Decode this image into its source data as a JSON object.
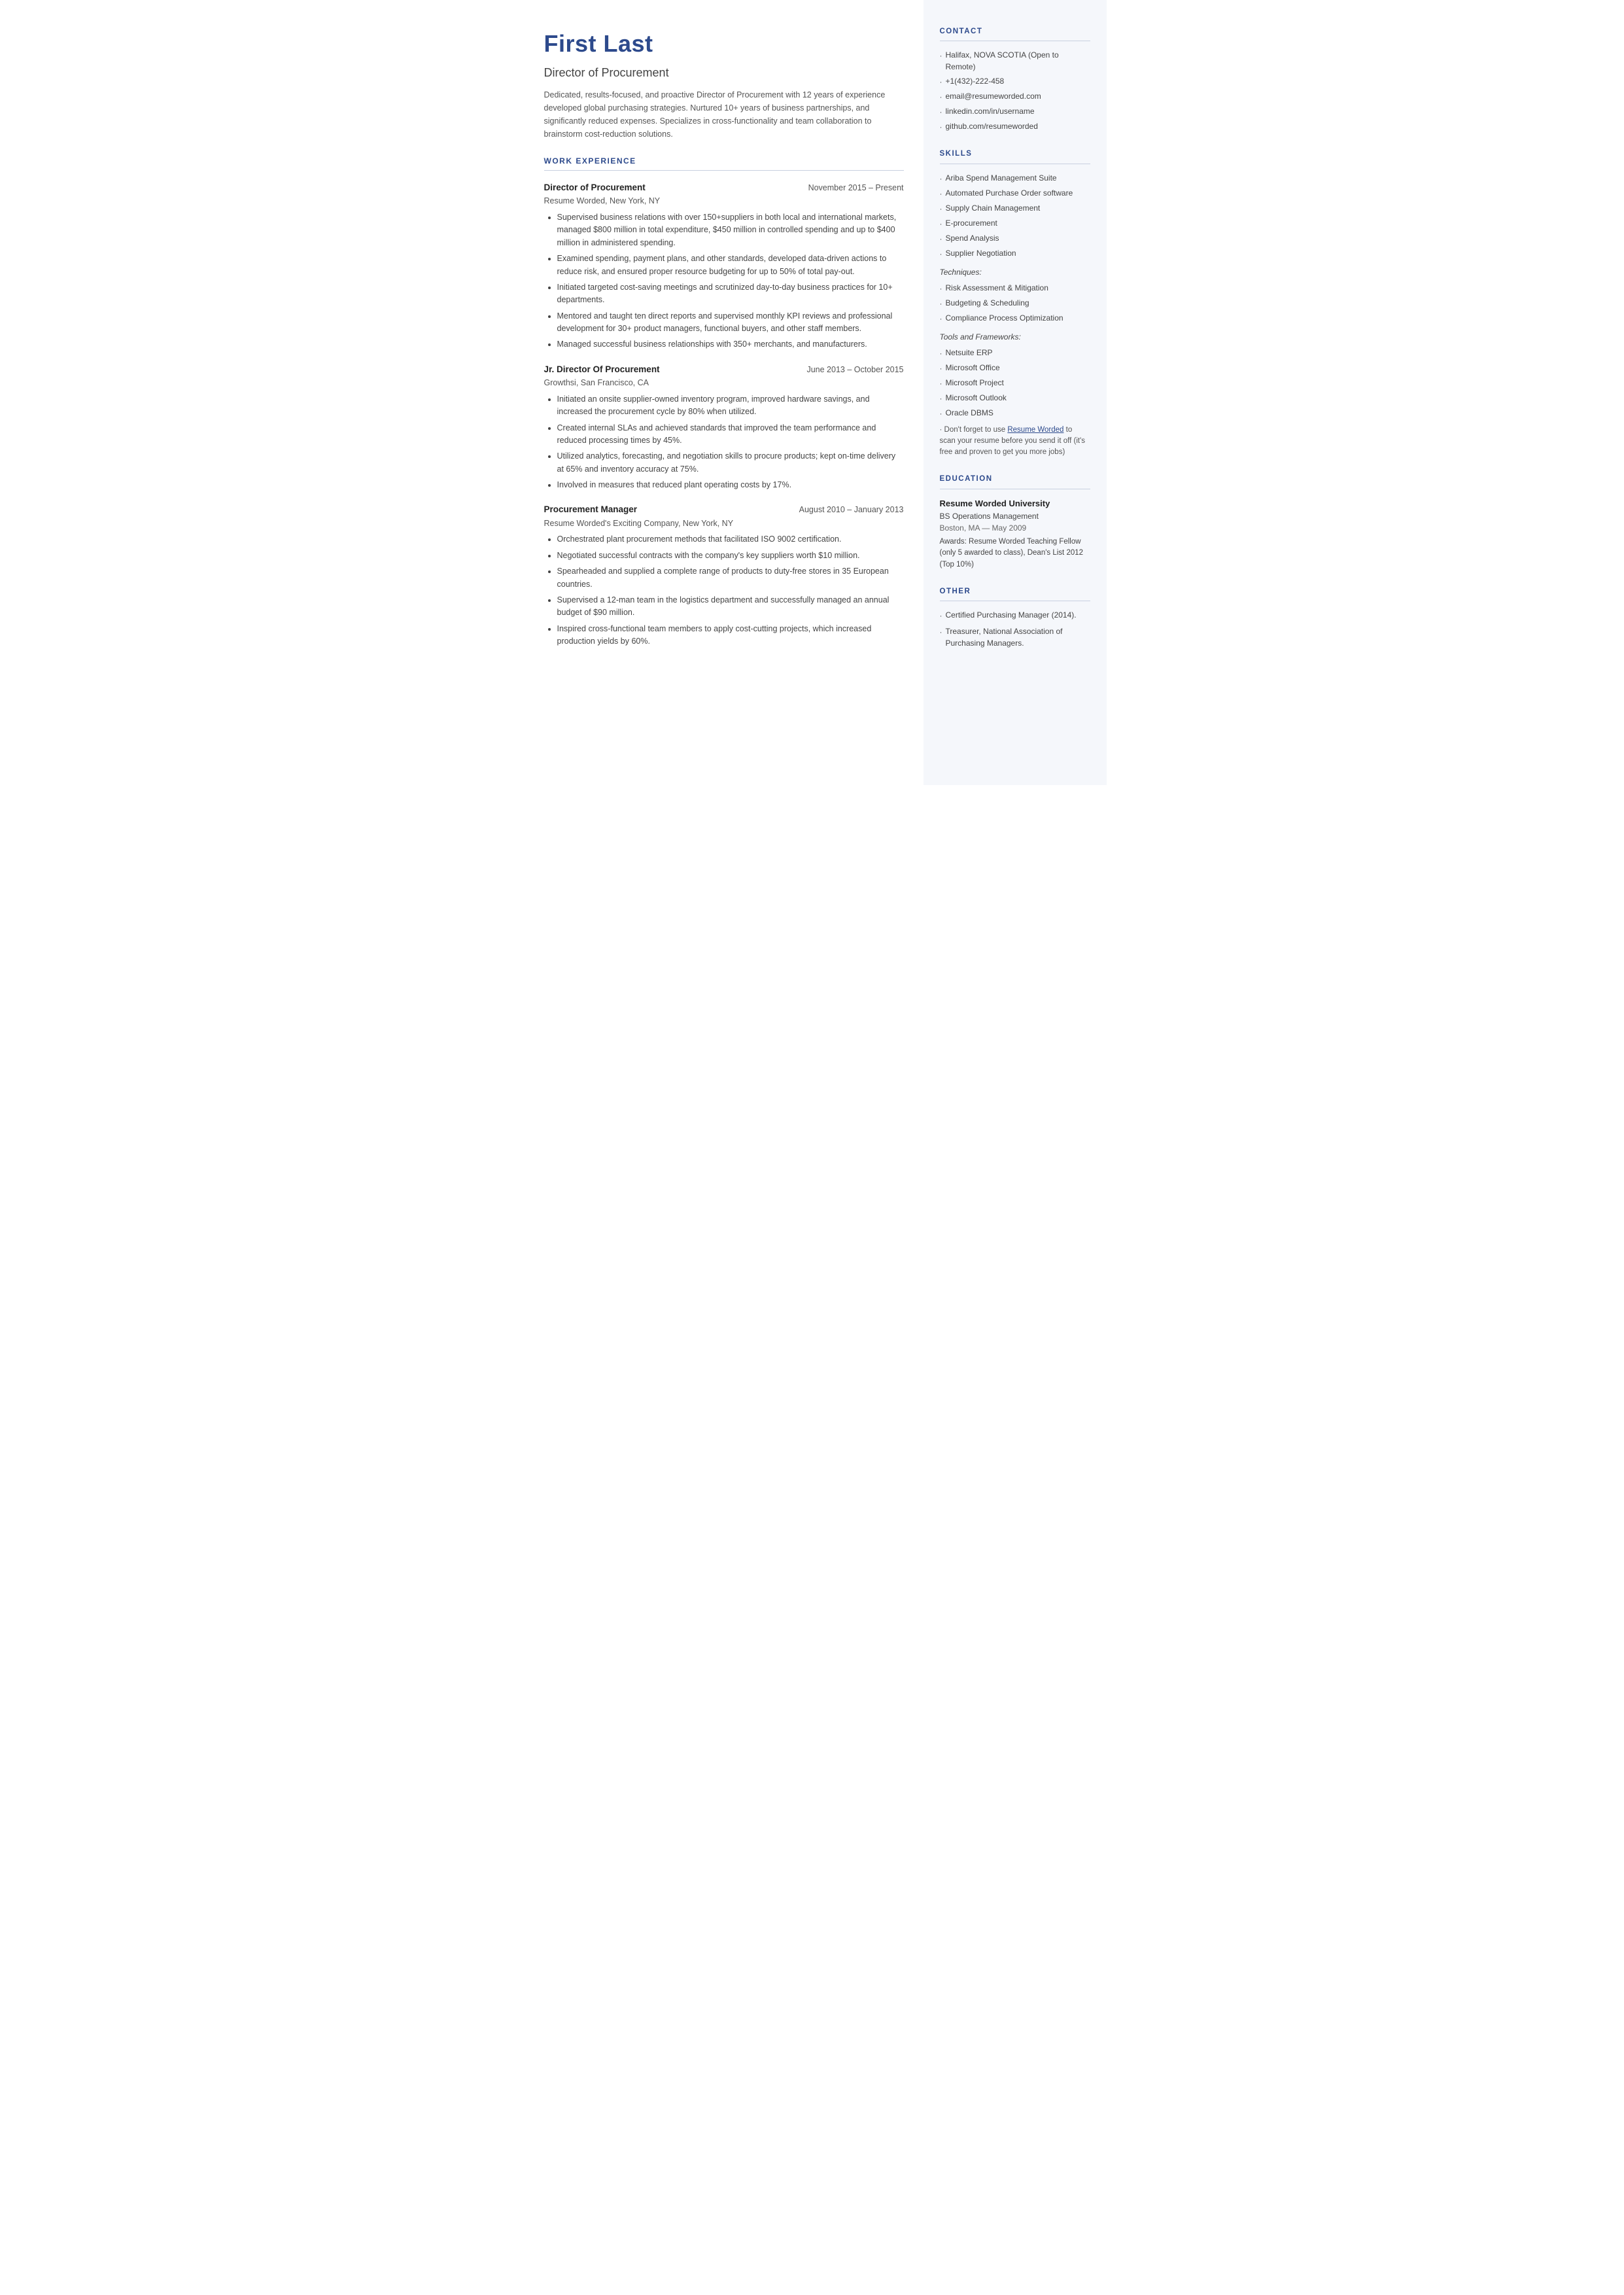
{
  "header": {
    "name": "First Last",
    "title": "Director of Procurement",
    "summary": "Dedicated, results-focused, and proactive Director of Procurement with 12 years of experience developed global purchasing strategies. Nurtured 10+ years of business partnerships, and significantly reduced expenses. Specializes in cross-functionality and team collaboration to brainstorm cost-reduction solutions."
  },
  "sections": {
    "work_experience_label": "WORK EXPERIENCE"
  },
  "jobs": [
    {
      "title": "Director of Procurement",
      "dates": "November 2015 – Present",
      "company": "Resume Worded, New York, NY",
      "bullets": [
        "Supervised business relations with over 150+suppliers in both local and international markets, managed $800 million in total expenditure, $450 million in controlled spending and up to $400 million in administered spending.",
        "Examined spending, payment plans, and other standards, developed data-driven actions to reduce risk, and ensured proper resource budgeting for up to 50% of total pay-out.",
        "Initiated targeted cost-saving meetings and scrutinized day-to-day business practices for 10+ departments.",
        "Mentored and taught ten direct reports and supervised monthly KPI reviews and professional development for 30+ product managers, functional buyers, and other staff members.",
        "Managed successful business relationships with 350+ merchants, and manufacturers."
      ]
    },
    {
      "title": "Jr. Director Of Procurement",
      "dates": "June 2013 – October 2015",
      "company": "Growthsi, San Francisco, CA",
      "bullets": [
        "Initiated an onsite supplier-owned inventory program, improved hardware savings, and increased the procurement cycle by 80% when utilized.",
        "Created internal SLAs and achieved standards that improved the team performance and reduced processing times by 45%.",
        "Utilized analytics, forecasting, and negotiation skills to procure products; kept on-time delivery at 65% and inventory accuracy at 75%.",
        "Involved in measures that reduced plant operating costs by 17%."
      ]
    },
    {
      "title": "Procurement Manager",
      "dates": "August 2010 – January 2013",
      "company": "Resume Worded's Exciting Company, New York, NY",
      "bullets": [
        "Orchestrated plant procurement methods that facilitated ISO 9002 certification.",
        "Negotiated successful contracts with the company's key suppliers worth $10 million.",
        "Spearheaded and supplied a complete range of products to duty-free stores in 35 European countries.",
        "Supervised a 12-man team in the logistics department and successfully managed an annual budget of $90 million.",
        "Inspired cross-functional team members to apply cost-cutting projects, which increased production yields by 60%."
      ]
    }
  ],
  "sidebar": {
    "contact_label": "CONTACT",
    "contact_items": [
      "Halifax, NOVA SCOTIA (Open to Remote)",
      "+1(432)-222-458",
      "email@resumeworded.com",
      "linkedin.com/in/username",
      "github.com/resumeworded"
    ],
    "skills_label": "SKILLS",
    "skills_core": [
      "Ariba Spend Management Suite",
      "Automated Purchase Order software",
      "Supply Chain Management",
      "E-procurement",
      "Spend Analysis",
      "Supplier Negotiation"
    ],
    "techniques_label": "Techniques:",
    "techniques": [
      "Risk Assessment & Mitigation",
      "Budgeting & Scheduling",
      "Compliance Process Optimization"
    ],
    "tools_label": "Tools and Frameworks:",
    "tools": [
      "Netsuite ERP",
      "Microsoft Office",
      "Microsoft Project",
      "Microsoft Outlook",
      "Oracle DBMS"
    ],
    "note_text": "Don't forget to use",
    "note_link": "Resume Worded",
    "note_rest": "to scan your resume before you send it off (it's free and proven to get you more jobs)",
    "education_label": "EDUCATION",
    "education": {
      "school": "Resume Worded University",
      "degree": "BS Operations Management",
      "meta": "Boston, MA — May 2009",
      "awards": "Awards: Resume Worded Teaching Fellow (only 5 awarded to class), Dean's List 2012 (Top 10%)"
    },
    "other_label": "OTHER",
    "other_items": [
      "Certified Purchasing Manager (2014).",
      "Treasurer, National Association of Purchasing Managers."
    ]
  }
}
